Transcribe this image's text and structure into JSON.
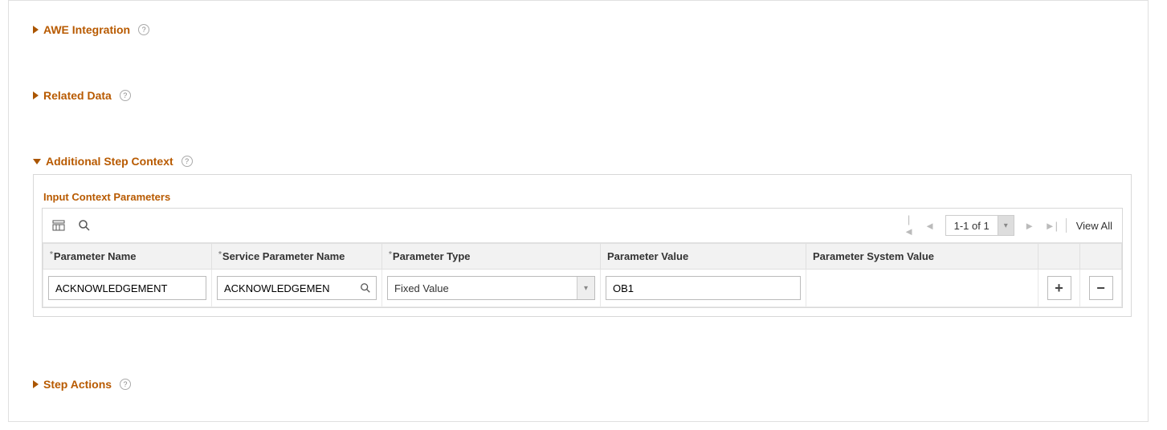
{
  "sections": {
    "awe_integration": {
      "title": "AWE Integration"
    },
    "related_data": {
      "title": "Related Data"
    },
    "additional_step_context": {
      "title": "Additional Step Context"
    },
    "step_actions": {
      "title": "Step Actions"
    }
  },
  "input_context": {
    "title": "Input Context Parameters",
    "paging": {
      "range": "1-1 of 1",
      "view_all": "View All"
    },
    "columns": {
      "parameter_name": "Parameter Name",
      "service_parameter_name": "Service Parameter Name",
      "parameter_type": "Parameter Type",
      "parameter_value": "Parameter Value",
      "parameter_system_value": "Parameter System Value"
    },
    "rows": [
      {
        "parameter_name": "ACKNOWLEDGEMENT",
        "service_parameter_name": "ACKNOWLEDGEMEN",
        "parameter_type": "Fixed Value",
        "parameter_value": "OB1",
        "parameter_system_value": ""
      }
    ]
  }
}
